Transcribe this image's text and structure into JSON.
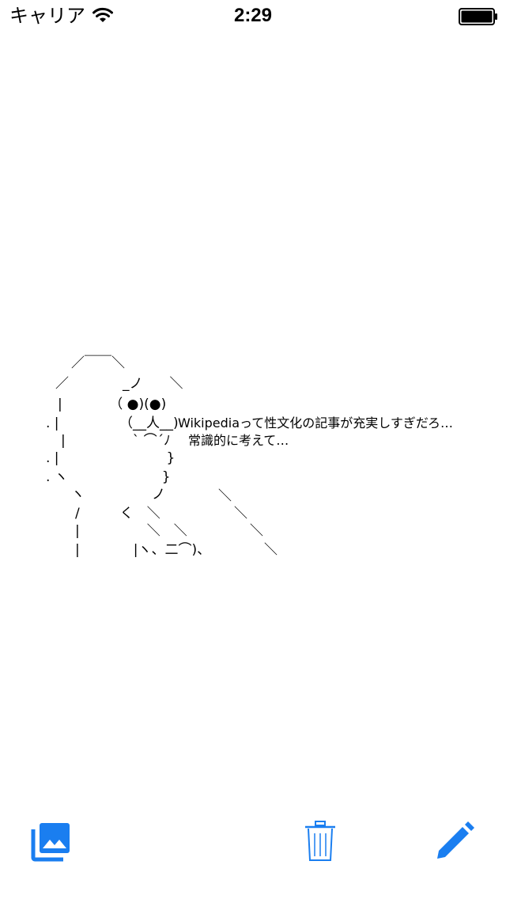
{
  "status_bar": {
    "carrier": "キャリア",
    "time": "2:29"
  },
  "art": {
    "lines": [
      "／￣￣＼",
      "／　　　　_ノ　　＼",
      "|　　　　（ ●)(●)",
      ". |　　　　　（__人__)",
      "|　　　　　` ⌒´ﾉ",
      ". |　　　　　　　　}",
      ". ヽ　　　　　　　}",
      "ヽ　　　　　ノ",
      "/　　　く　＼",
      "|　　　　　＼　＼",
      "|　　　　|ヽ、二⌒)、"
    ],
    "slashes": [
      "＼",
      "＼",
      "＼",
      "＼"
    ],
    "speech_line1": "Wikipediaって性文化の記事が充実しすぎだろ…",
    "speech_line2": "常識的に考えて…"
  },
  "toolbar": {
    "gallery_icon": "photo-library-icon",
    "delete_icon": "trash-icon",
    "edit_icon": "pencil-icon",
    "accent_color": "#1a7ef0"
  }
}
